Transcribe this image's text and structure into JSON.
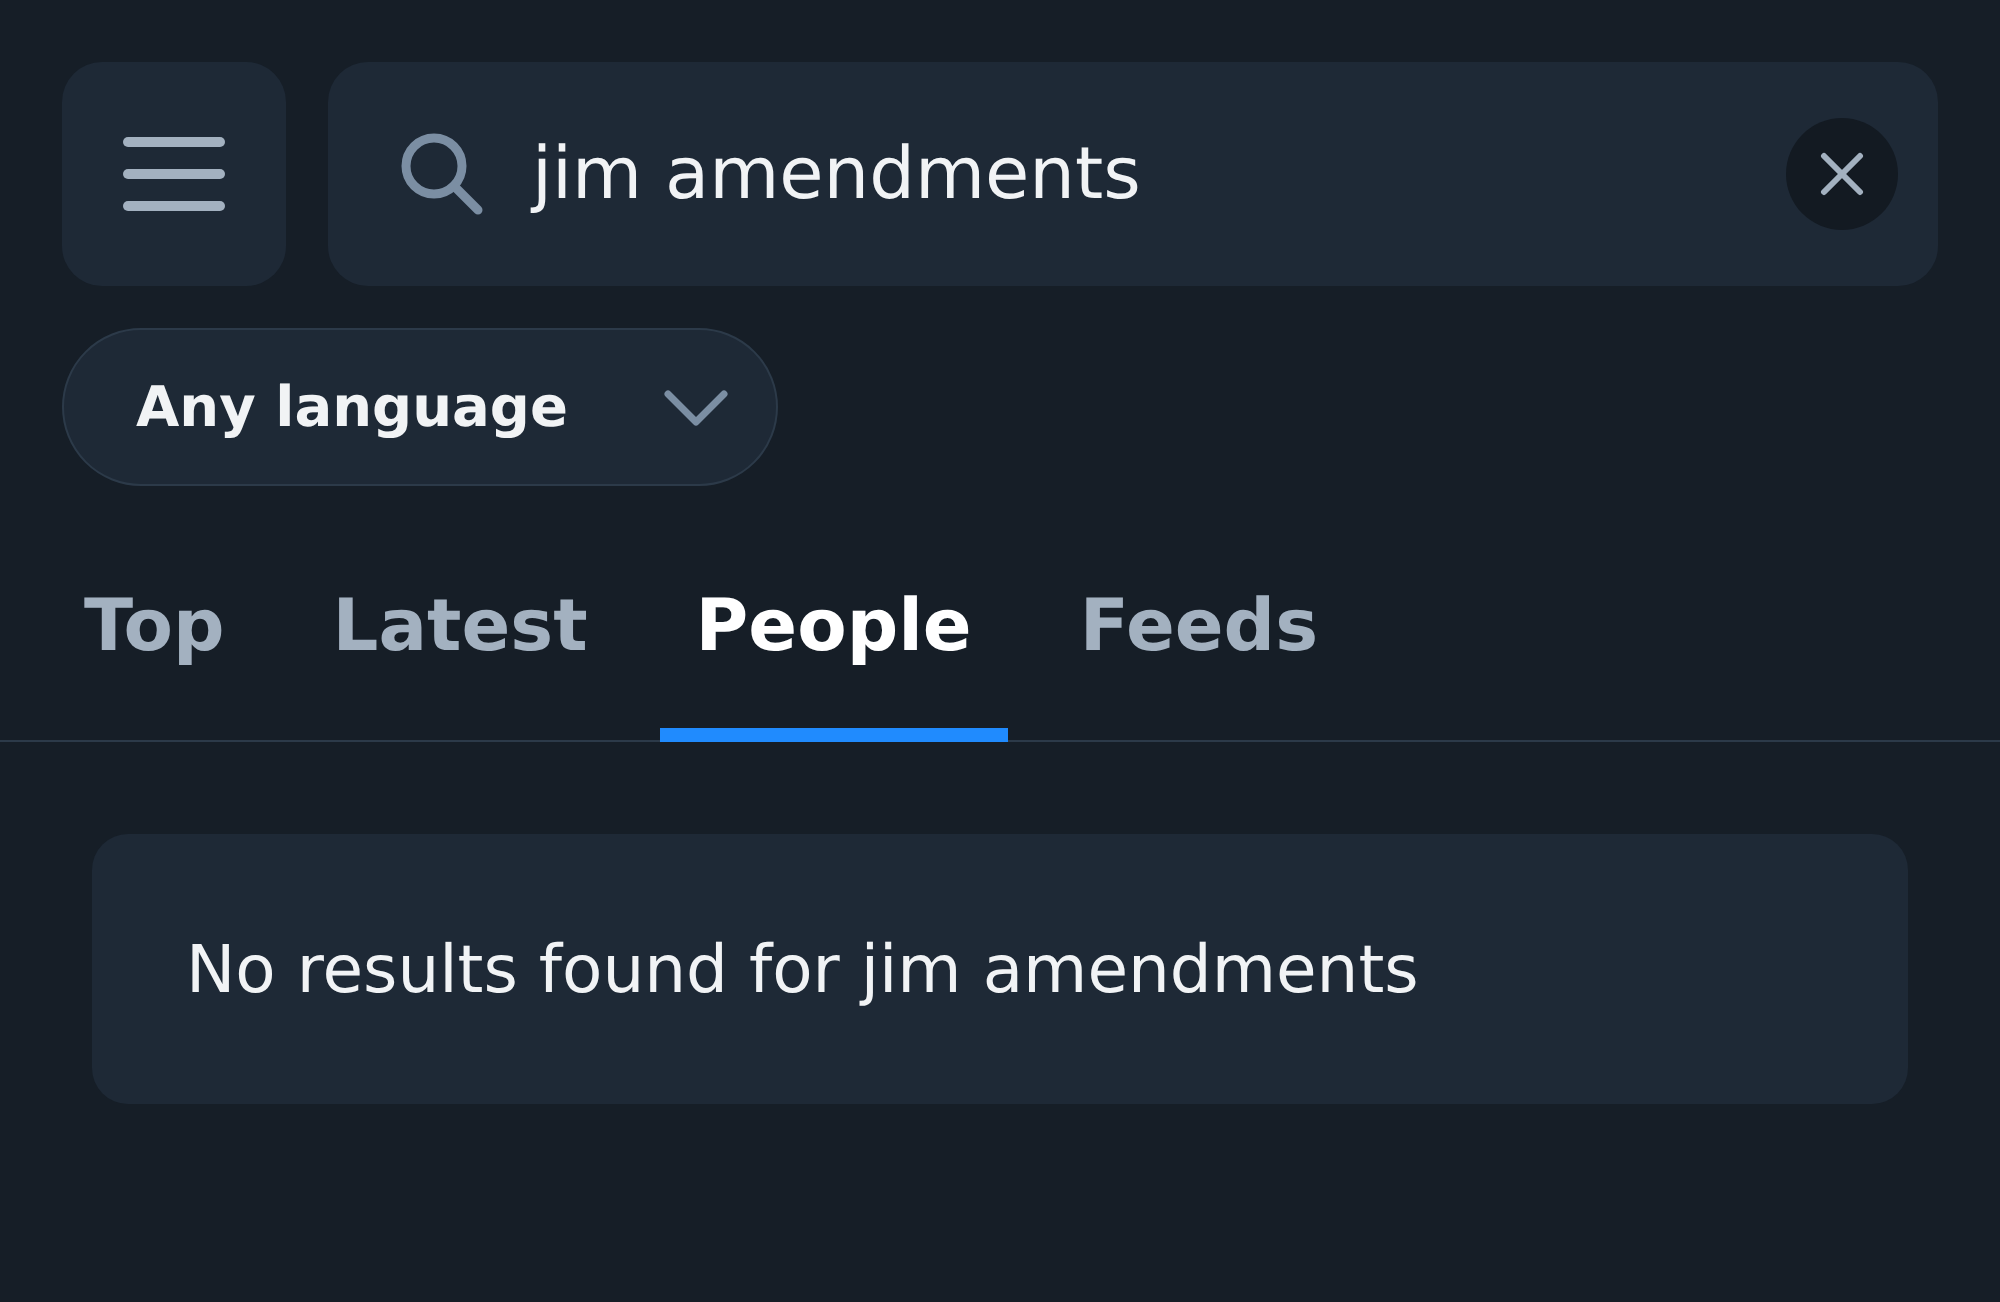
{
  "search": {
    "value": "jim amendments"
  },
  "language_filter": {
    "label": "Any language"
  },
  "tabs": [
    {
      "label": "Top",
      "selected": false
    },
    {
      "label": "Latest",
      "selected": false
    },
    {
      "label": "People",
      "selected": true
    },
    {
      "label": "Feeds",
      "selected": false
    }
  ],
  "message": "No results found for jim amendments"
}
